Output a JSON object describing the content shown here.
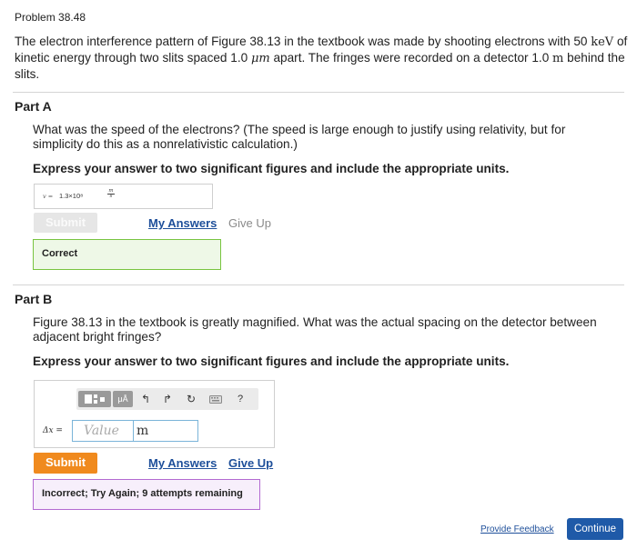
{
  "problem": {
    "label": "Problem 38.48",
    "text_1": "The electron interference pattern of Figure 38.13 in the textbook was made by shooting electrons with 50 ",
    "energy_unit": "keV",
    "text_2": " of kinetic energy through two slits spaced 1.0 ",
    "spacing_unit": "μm",
    "text_3": " apart. The fringes were recorded on a detector 1.0 ",
    "distance_unit": "m",
    "text_4": " behind the slits."
  },
  "part_a": {
    "title": "Part A",
    "question": "What was the speed of the electrons? (The speed is large enough to justify using relativity, but for simplicity do this as a nonrelativistic calculation.)",
    "instruction": "Express your answer to two significant figures and include the appropriate units.",
    "answer": {
      "variable": "v =",
      "value": "1.3×10⁸",
      "unit_num": "m",
      "unit_den": "s"
    },
    "submit_label": "Submit",
    "my_answers_label": "My Answers",
    "give_up_label": "Give Up",
    "feedback": "Correct"
  },
  "part_b": {
    "title": "Part B",
    "question": "Figure 38.13 in the textbook is greatly magnified. What was the actual spacing on the detector between adjacent bright fringes?",
    "instruction": "Express your answer to two significant figures and include the appropriate units.",
    "toolbar": {
      "units_label": "μÅ",
      "help_label": "?"
    },
    "variable_label": "Δx =",
    "value_placeholder": "Value",
    "unit_value": "m",
    "submit_label": "Submit",
    "my_answers_label": "My Answers",
    "give_up_label": "Give Up",
    "feedback": "Incorrect; Try Again; 9 attempts remaining"
  },
  "footer": {
    "provide_feedback_label": "Provide Feedback",
    "continue_label": "Continue"
  },
  "colors": {
    "submit_orange": "#f08a1e",
    "link_blue": "#1e4f9a",
    "correct_green": "#78c440",
    "incorrect_purple": "#b36ad1",
    "continue_blue": "#1f5aa8"
  }
}
